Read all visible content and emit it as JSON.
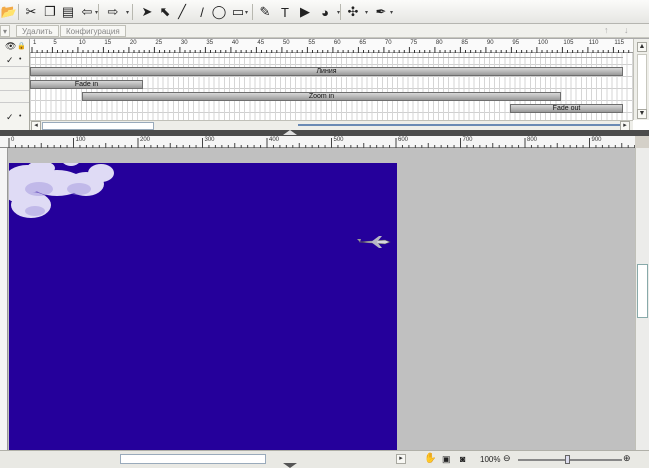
{
  "toolbar": {
    "icons": [
      "folder-open-icon",
      "cut-icon",
      "copy-icon",
      "paste-icon",
      "undo-icon",
      "redo-icon",
      "select-arrow-icon",
      "direct-select-icon",
      "line-icon",
      "pen-line-icon",
      "ellipse-icon",
      "rectangle-icon",
      "pencil-icon",
      "text-icon",
      "play-icon",
      "globe-icon",
      "magic-wand-icon",
      "marker-icon"
    ],
    "glyphs": [
      "📂",
      "✂",
      "❐",
      "▤",
      "⇦",
      "⇨",
      "➤",
      "⬉",
      "╱",
      "/",
      "◯",
      "▭",
      "✎",
      "T",
      "▶",
      "◕",
      "✣",
      "✒"
    ]
  },
  "timeline_toolbar": {
    "delete_label": "Удалить",
    "config_label": "Конфигурация"
  },
  "timeline": {
    "ruler_ticks": [
      "1",
      "5",
      "10",
      "15",
      "20",
      "25",
      "30",
      "35",
      "40",
      "45",
      "50",
      "55",
      "60",
      "65",
      "70",
      "75",
      "80",
      "85",
      "90",
      "95",
      "100",
      "105",
      "110",
      "115"
    ],
    "clips": [
      {
        "label": "Линия"
      },
      {
        "label": "Fade in"
      },
      {
        "label": "Zoom in"
      },
      {
        "label": "Fade out"
      }
    ]
  },
  "main_ruler": {
    "ticks": [
      "0",
      "100",
      "200",
      "300",
      "400",
      "500",
      "600",
      "700",
      "800",
      "900"
    ]
  },
  "status": {
    "zoom_label": "100%"
  },
  "colors": {
    "canvas_bg": "#25009b",
    "workspace_bg": "#c0c0c0"
  }
}
